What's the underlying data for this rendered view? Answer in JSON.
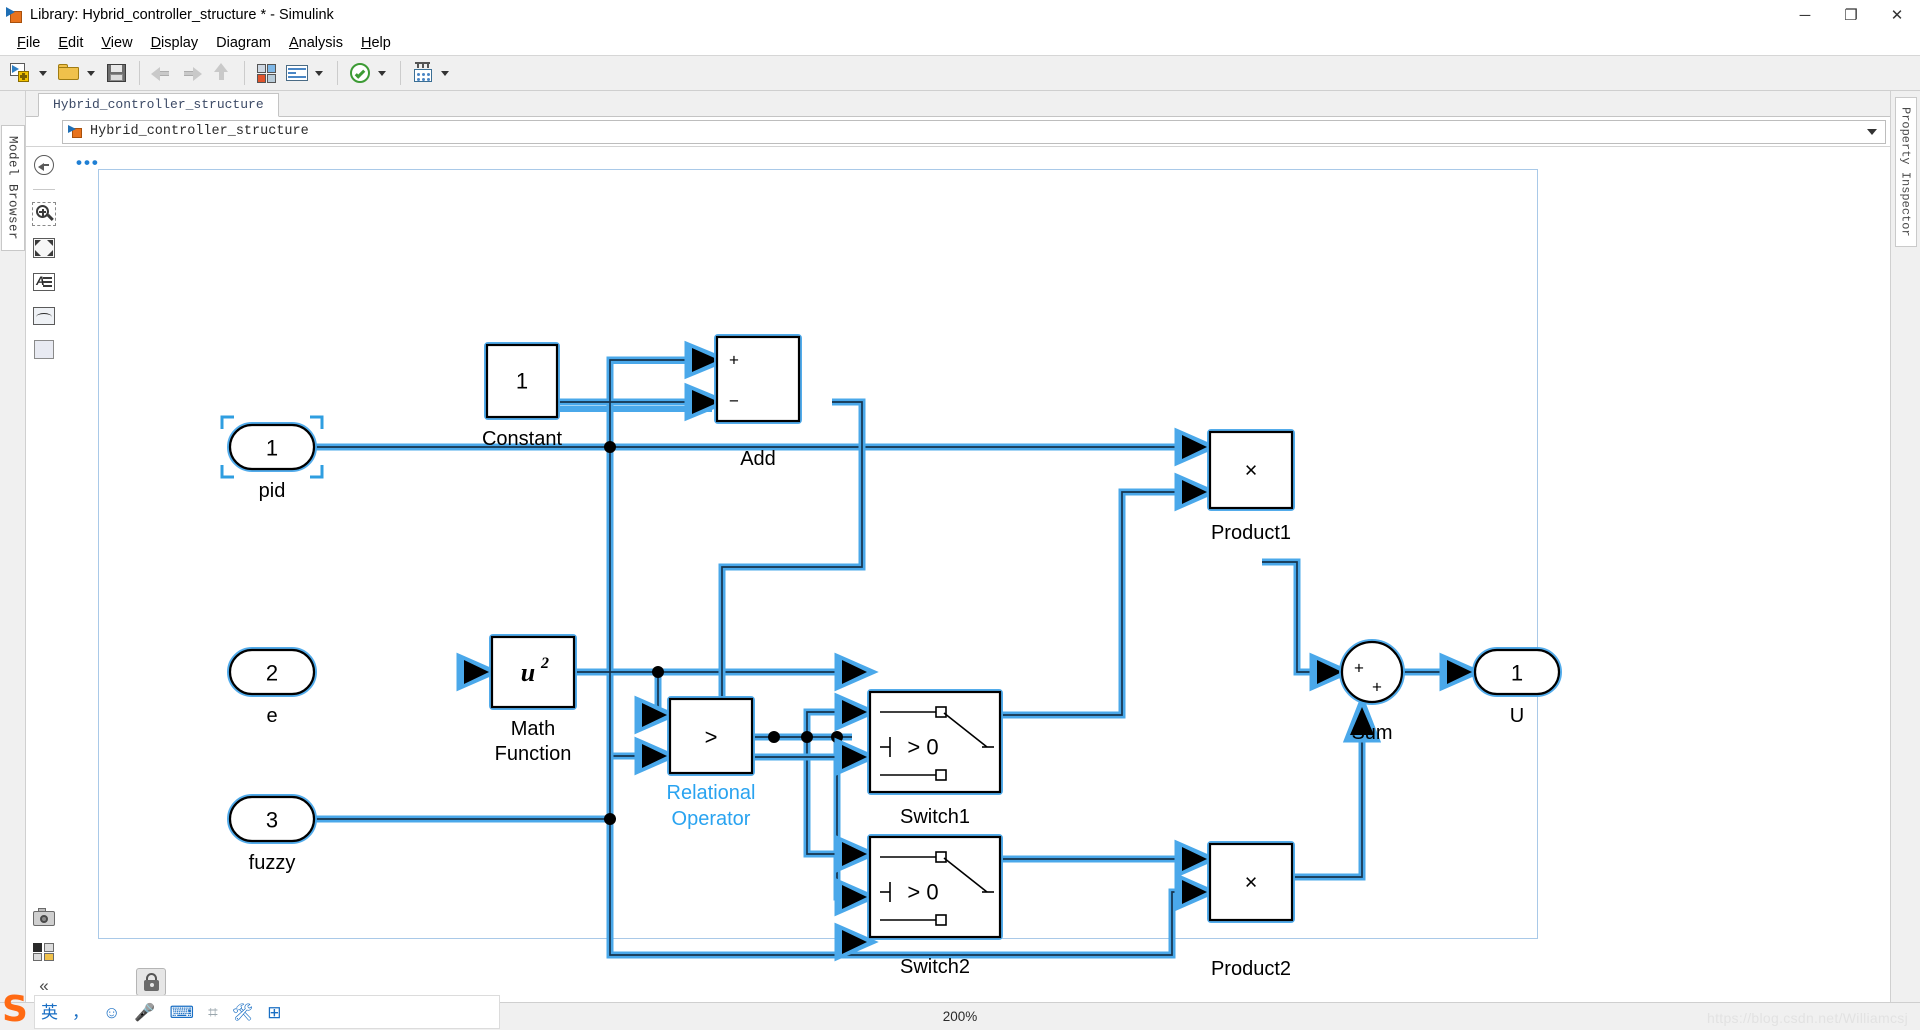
{
  "window": {
    "title": "Library: Hybrid_controller_structure * - Simulink",
    "app_icon": "simulink-library-icon",
    "minimize": "─",
    "maximize": "❐",
    "close": "✕"
  },
  "menubar": {
    "items": [
      {
        "label": "File",
        "mnemonic": "F"
      },
      {
        "label": "Edit",
        "mnemonic": "E"
      },
      {
        "label": "View",
        "mnemonic": "V"
      },
      {
        "label": "Display",
        "mnemonic": "D"
      },
      {
        "label": "Diagram",
        "mnemonic": "g"
      },
      {
        "label": "Analysis",
        "mnemonic": "A"
      },
      {
        "label": "Help",
        "mnemonic": "H"
      }
    ]
  },
  "toolbar": {
    "items": [
      {
        "name": "new-model-button",
        "icon": "new-model-icon",
        "has_caret": true,
        "enabled": true
      },
      {
        "name": "open-model-button",
        "icon": "open-folder-icon",
        "has_caret": true,
        "enabled": true
      },
      {
        "name": "save-model-button",
        "icon": "save-icon",
        "has_caret": false,
        "enabled": true
      },
      {
        "name": "back-button",
        "icon": "back-arrow-icon",
        "has_caret": false,
        "enabled": false
      },
      {
        "name": "forward-button",
        "icon": "forward-arrow-icon",
        "has_caret": false,
        "enabled": false
      },
      {
        "name": "up-to-parent-button",
        "icon": "up-arrow-icon",
        "has_caret": false,
        "enabled": false
      },
      {
        "name": "library-browser-button",
        "icon": "library-browser-icon",
        "has_caret": false,
        "enabled": true
      },
      {
        "name": "model-explorer-button",
        "icon": "model-explorer-icon",
        "has_caret": true,
        "enabled": true
      },
      {
        "name": "update-model-button",
        "icon": "check-circle-icon",
        "has_caret": true,
        "enabled": true
      },
      {
        "name": "run-button",
        "icon": "simulation-icon",
        "has_caret": true,
        "enabled": true
      }
    ]
  },
  "left_rail": {
    "model_browser_label": "Model Browser"
  },
  "right_rail": {
    "property_inspector_label": "Property Inspector"
  },
  "tabs": {
    "document_tab": "Hybrid_controller_structure"
  },
  "breadcrumb": {
    "icon": "simulink-library-icon",
    "path": "Hybrid_controller_structure",
    "dropdown_icon": "chevron-down-icon"
  },
  "canvas_tools": {
    "items": [
      {
        "name": "navigate-back-button",
        "icon": "back-circle-icon"
      },
      {
        "name": "zoom-button",
        "icon": "magnifier-icon"
      },
      {
        "name": "fit-to-view-button",
        "icon": "fit-to-view-icon"
      },
      {
        "name": "annotation-button",
        "icon": "annotation-icon"
      },
      {
        "name": "scope-viewer-button",
        "icon": "scope-icon"
      },
      {
        "name": "area-button",
        "icon": "area-icon"
      }
    ],
    "bottom_items": [
      {
        "name": "screenshot-button",
        "icon": "camera-icon"
      },
      {
        "name": "layout-button",
        "icon": "layout-icon"
      },
      {
        "name": "collapse-button",
        "icon": "double-chevron-left-icon",
        "glyph": "«"
      }
    ],
    "unlock_button": {
      "name": "unlock-library-button",
      "icon": "unlock-icon"
    },
    "overflow_ellipsis": "•••"
  },
  "statusbar": {
    "zoom_level": "200%",
    "watermark": "https://blog.csdn.net/Williamcsj"
  },
  "ime": {
    "logo": "S",
    "icons": [
      {
        "name": "ime-language-icon",
        "glyph": "英",
        "gray": false
      },
      {
        "name": "ime-punctuation-icon",
        "glyph": "，",
        "gray": false
      },
      {
        "name": "ime-emoji-icon",
        "glyph": "☺",
        "gray": false
      },
      {
        "name": "ime-voice-icon",
        "glyph": "Ἲ4",
        "gray": false
      },
      {
        "name": "ime-keyboard-icon",
        "glyph": "⌨",
        "gray": false
      },
      {
        "name": "ime-screenshot-icon",
        "glyph": "⌗",
        "gray": true
      },
      {
        "name": "ime-toolbox-icon",
        "glyph": "✂",
        "gray": false
      },
      {
        "name": "ime-apps-icon",
        "glyph": "⊞",
        "gray": false
      }
    ]
  },
  "diagram": {
    "title": "Hybrid_controller_structure",
    "blocks": [
      {
        "id": "constant",
        "type": "Constant",
        "label": "Constant",
        "text": "1",
        "selected": true,
        "label_color": "#000000"
      },
      {
        "id": "add",
        "type": "Add",
        "label": "Add",
        "signs": [
          "+",
          "−"
        ],
        "selected": true,
        "label_color": "#000000"
      },
      {
        "id": "in_pid",
        "type": "Inport",
        "label": "pid",
        "text": "1",
        "selected": true,
        "handles": true,
        "label_color": "#000000"
      },
      {
        "id": "in_e",
        "type": "Inport",
        "label": "e",
        "text": "2",
        "selected": true,
        "label_color": "#000000"
      },
      {
        "id": "in_fuzzy",
        "type": "Inport",
        "label": "fuzzy",
        "text": "3",
        "selected": true,
        "label_color": "#000000"
      },
      {
        "id": "mathfcn",
        "type": "Math Function",
        "label": "Math\nFunction",
        "text": "u^2",
        "selected": true,
        "label_color": "#000000"
      },
      {
        "id": "relop",
        "type": "Relational Operator",
        "label": "Relational\nOperator",
        "text": ">",
        "selected": true,
        "label_color": "#29a3f0"
      },
      {
        "id": "switch1",
        "type": "Switch",
        "label": "Switch1",
        "text": "> 0",
        "selected": true,
        "label_color": "#000000"
      },
      {
        "id": "switch2",
        "type": "Switch",
        "label": "Switch2",
        "text": "> 0",
        "selected": true,
        "label_color": "#000000"
      },
      {
        "id": "product1",
        "type": "Product",
        "label": "Product1",
        "text": "×",
        "selected": true,
        "label_color": "#000000"
      },
      {
        "id": "product2",
        "type": "Product",
        "label": "Product2",
        "text": "×",
        "selected": true,
        "label_color": "#000000"
      },
      {
        "id": "sum",
        "type": "Sum",
        "label": "Sum",
        "signs": [
          "+",
          "+"
        ],
        "selected": true,
        "label_color": "#000000"
      },
      {
        "id": "out_U",
        "type": "Outport",
        "label": "U",
        "text": "1",
        "selected": true,
        "label_color": "#000000"
      }
    ],
    "colors": {
      "selection": "#4aa8ea",
      "wire": "#4aa8ea",
      "wire_core": "#16344d",
      "block_stroke": "#000000",
      "block_fill": "#ffffff",
      "selected_label": "#29a3f0",
      "frame": "#a9c9e8"
    }
  }
}
